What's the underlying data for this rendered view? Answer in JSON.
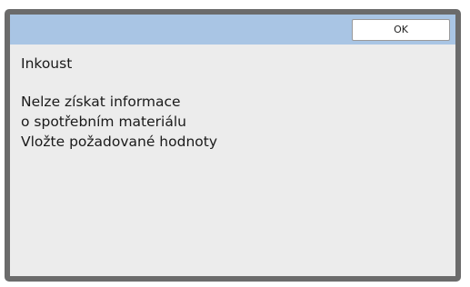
{
  "dialog": {
    "ok_label": "OK",
    "heading": "Inkoust",
    "message_lines": [
      "Nelze získat informace",
      "o spotřebním materiálu",
      "Vložte požadované hodnoty"
    ]
  },
  "colors": {
    "title_bar": "#a9c5e4",
    "dialog_background": "#ececec",
    "frame": "#6b6b6b",
    "button_background": "#ffffff"
  }
}
